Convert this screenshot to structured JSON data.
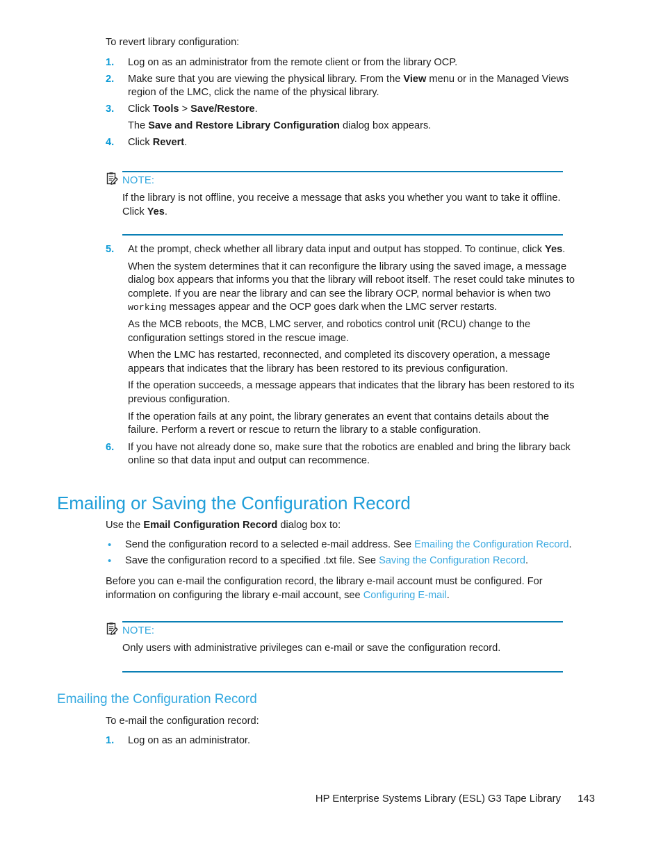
{
  "document": {
    "page_number": "143",
    "footer_title": "HP Enterprise Systems Library (ESL) G3 Tape Library",
    "accent_color": "#0096d6",
    "link_color": "#3ba9e0",
    "heading_color": "#1f9ed9",
    "rule_color": "#0a7fb5"
  },
  "revert_section": {
    "lead_in": "To revert library configuration:",
    "steps": [
      {
        "number": "1.",
        "paragraphs": [
          {
            "text": "Log on as an administrator from the remote client or from the library OCP."
          }
        ]
      },
      {
        "number": "2.",
        "paragraphs": [
          {
            "pre": "Make sure that you are viewing the physical library. From the ",
            "bold": "View",
            "post": " menu or in the Managed Views region of the LMC, click the name of the physical library."
          }
        ]
      },
      {
        "number": "3.",
        "paragraphs": [
          {
            "pre": "Click ",
            "bold": "Tools",
            "mid": " > ",
            "bold2": "Save/Restore",
            "post": "."
          },
          {
            "pre": "The ",
            "bold": "Save and Restore Library Configuration",
            "post": " dialog box appears."
          }
        ]
      },
      {
        "number": "4.",
        "paragraphs": [
          {
            "pre": "Click ",
            "bold": "Revert",
            "post": "."
          }
        ]
      }
    ],
    "note1": {
      "icon": "note-clipboard-icon",
      "label": "NOTE:",
      "pre": "If the library is not offline, you receive a message that asks you whether you want to take it offline. Click ",
      "bold": "Yes",
      "post": "."
    },
    "steps_continued": [
      {
        "number": "5.",
        "paragraphs": [
          {
            "pre": "At the prompt, check whether all library data input and output has stopped. To continue, click ",
            "bold": "Yes",
            "post": "."
          },
          {
            "pre": "When the system determines that it can reconfigure the library using the saved image, a message dialog box appears that informs you that the library will reboot itself. The reset could take minutes to complete. If you are near the library and can see the library OCP, normal behavior is when two ",
            "mono": "working",
            "post": " messages appear and the OCP goes dark when the LMC server restarts."
          },
          {
            "text": "As the MCB reboots, the MCB, LMC server, and robotics control unit (RCU) change to the configuration settings stored in the rescue image."
          },
          {
            "text": "When the LMC has restarted, reconnected, and completed its discovery operation, a message appears that indicates that the library has been restored to its previous configuration."
          },
          {
            "text": "If the operation succeeds, a message appears that indicates that the library has been restored to its previous configuration."
          },
          {
            "text": "If the operation fails at any point, the library generates an event that contains details about the failure. Perform a revert or rescue to return the library to a stable configuration."
          }
        ]
      },
      {
        "number": "6.",
        "paragraphs": [
          {
            "text": "If you have not already done so, make sure that the robotics are enabled and bring the library back online so that data input and output can recommence."
          }
        ]
      }
    ]
  },
  "emailing_section": {
    "heading": "Emailing or Saving the Configuration Record",
    "intro": {
      "pre": "Use the ",
      "bold": "Email Configuration Record",
      "post": " dialog box to:"
    },
    "bullets": [
      {
        "marker": "•",
        "pre": "Send the configuration record to a selected e-mail address. See ",
        "link": "Emailing the Configuration Record",
        "post": "."
      },
      {
        "marker": "•",
        "pre": "Save the configuration record to a specified .txt file. See ",
        "link": "Saving the Configuration Record",
        "post": "."
      }
    ],
    "paragraph": {
      "pre": "Before you can e-mail the configuration record, the library e-mail account must be configured. For information on configuring the library e-mail account, see ",
      "link": "Configuring E-mail",
      "post": "."
    },
    "note2": {
      "icon": "note-clipboard-icon",
      "label": "NOTE:",
      "text": "Only users with administrative privileges can e-mail or save the configuration record."
    },
    "subsection": {
      "heading": "Emailing the Configuration Record",
      "lead_in": "To e-mail the configuration record:",
      "steps": [
        {
          "number": "1.",
          "text": "Log on as an administrator."
        }
      ]
    }
  }
}
